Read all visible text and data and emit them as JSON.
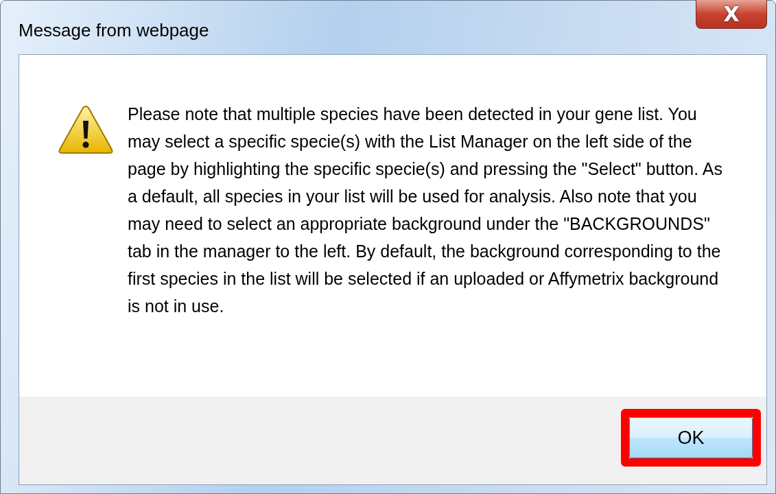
{
  "window": {
    "title": "Message from webpage",
    "close_label": "X"
  },
  "message": "Please note that multiple species have been detected in your gene list.  You may select a specific specie(s) with the List Manager on the left side of the page by highlighting the specific specie(s) and pressing the \"Select\" button.  As a default, all species in your list will be used for analysis.  Also note that you may need to select an appropriate background under the \"BACKGROUNDS\" tab in the manager to the left.  By default, the background corresponding to the first species in the list will be selected if an uploaded or Affymetrix background is not in use.",
  "buttons": [
    {
      "label": "OK",
      "highlighted": true
    }
  ]
}
